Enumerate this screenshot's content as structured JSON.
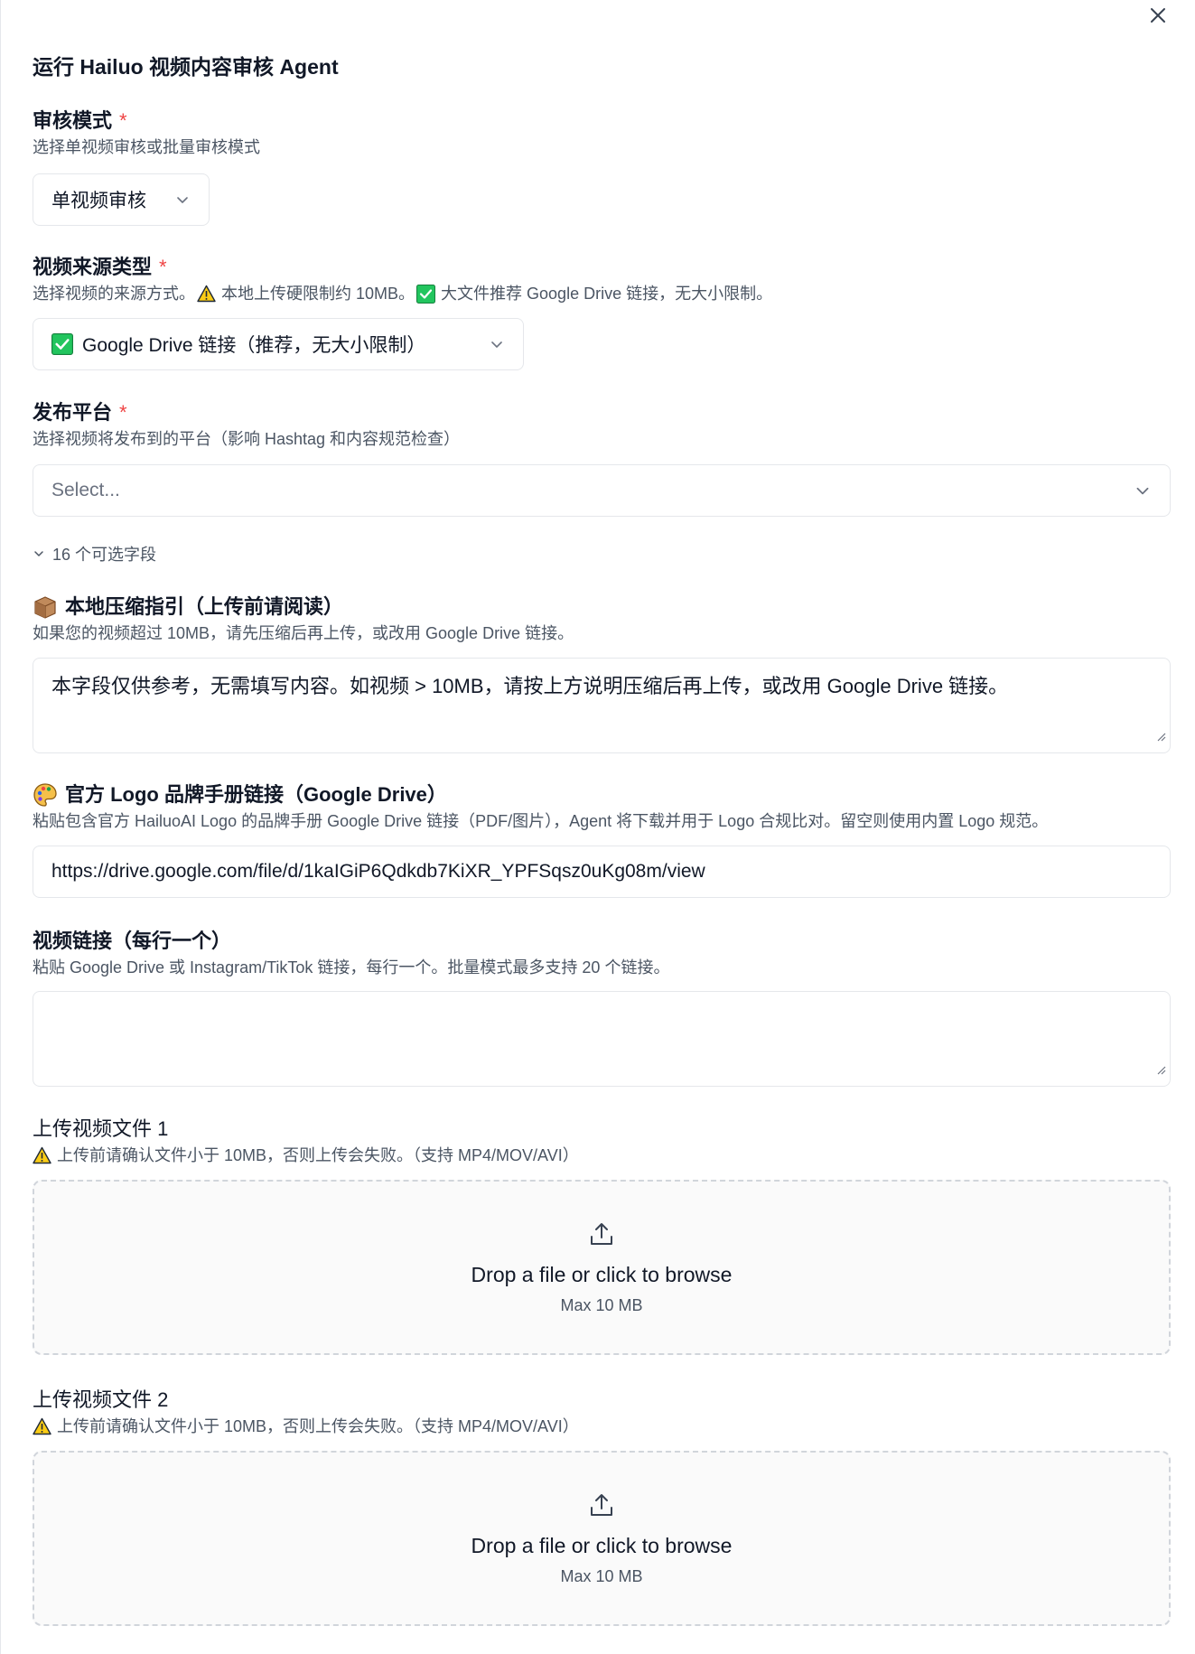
{
  "panel": {
    "title": "运行 Hailuo 视频内容审核 Agent"
  },
  "review_mode": {
    "label": "审核模式",
    "required_mark": "*",
    "description": "选择单视频审核或批量审核模式",
    "selected": "单视频审核"
  },
  "source_type": {
    "label": "视频来源类型",
    "required_mark": "*",
    "description_part1": "选择视频的来源方式。",
    "description_part2": "本地上传硬限制约 10MB。",
    "description_part3": "大文件推荐 Google Drive 链接，无大小限制。",
    "selected": "Google Drive 链接（推荐，无大小限制）"
  },
  "platform": {
    "label": "发布平台",
    "required_mark": "*",
    "description": "选择视频将发布到的平台（影响 Hashtag 和内容规范检查）",
    "placeholder": "Select..."
  },
  "optional_toggle": {
    "label": "16 个可选字段"
  },
  "compress_guide": {
    "label": "本地压缩指引（上传前请阅读）",
    "description": "如果您的视频超过 10MB，请先压缩后再上传，或改用 Google Drive 链接。",
    "value": "本字段仅供参考，无需填写内容。如视频 > 10MB，请按上方说明压缩后再上传，或改用 Google Drive 链接。"
  },
  "brand_manual": {
    "label": "官方 Logo 品牌手册链接（Google Drive）",
    "description": "粘贴包含官方 HailuoAI Logo 的品牌手册 Google Drive 链接（PDF/图片），Agent 将下载并用于 Logo 合规比对。留空则使用内置 Logo 规范。",
    "value": "https://drive.google.com/file/d/1kaIGiP6Qdkdb7KiXR_YPFSqsz0uKg08m/view"
  },
  "video_links": {
    "label": "视频链接（每行一个）",
    "description": "粘贴 Google Drive 或 Instagram/TikTok 链接，每行一个。批量模式最多支持 20 个链接。",
    "value": ""
  },
  "upload1": {
    "label": "上传视频文件 1",
    "description": "上传前请确认文件小于 10MB，否则上传会失败。（支持 MP4/MOV/AVI）",
    "drop_text": "Drop a file or click to browse",
    "max_text": "Max 10 MB"
  },
  "upload2": {
    "label": "上传视频文件 2",
    "description": "上传前请确认文件小于 10MB，否则上传会失败。（支持 MP4/MOV/AVI）",
    "drop_text": "Drop a file or click to browse",
    "max_text": "Max 10 MB"
  },
  "colors": {
    "required": "#ef4444",
    "border": "#e5e7eb",
    "check_green": "#22c55e",
    "warning_yellow": "#facc15"
  },
  "icons": {
    "close": "close-icon",
    "chevron": "chevron-down-icon",
    "warning": "warning-icon",
    "check": "check-box-icon",
    "package": "package-icon",
    "palette": "palette-icon",
    "upload": "upload-icon"
  }
}
